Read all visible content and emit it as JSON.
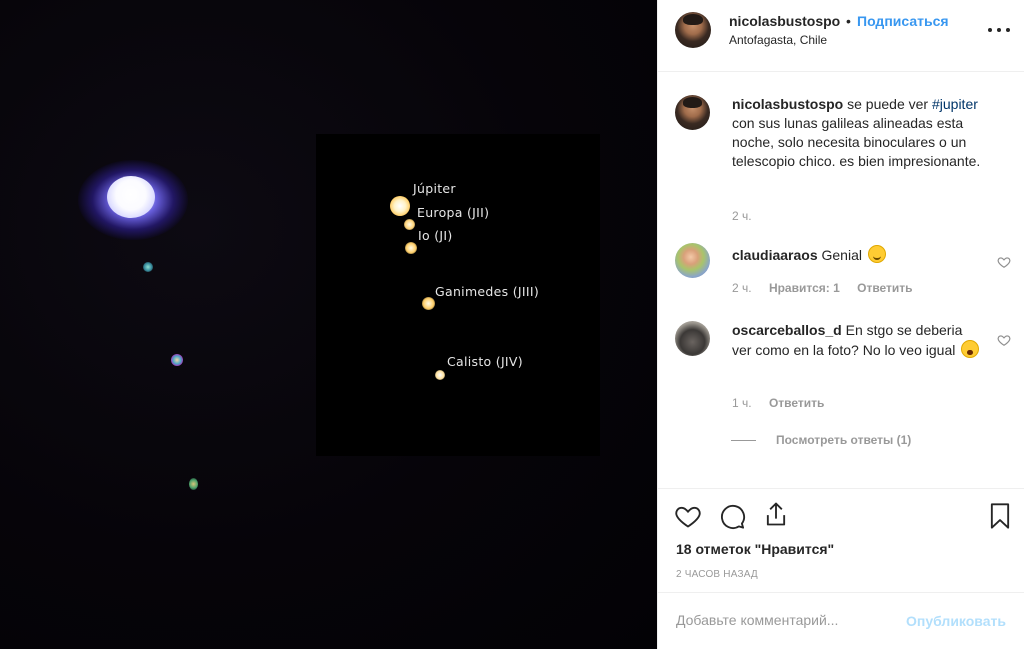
{
  "photo": {
    "labels": {
      "jupiter": "Júpiter",
      "europa": "Europa (JII)",
      "io": "Io (JI)",
      "ganimedes": "Ganimedes (JIII)",
      "calisto": "Calisto (JIV)"
    }
  },
  "header": {
    "username": "nicolasbustospo",
    "separator": "•",
    "follow_label": "Подписаться",
    "location": "Antofagasta, Chile",
    "more_icon": "more-horizontal-icon"
  },
  "caption": {
    "username": "nicolasbustospo",
    "text_before": " se puede ver ",
    "hashtag": "#jupiter",
    "text_after": " con sus lunas galileas alineadas esta noche, solo necesita binoculares o un telescopio chico. es bien impresionante.",
    "time": "2 ч."
  },
  "comments": [
    {
      "username": "claudiaaraos",
      "text": " Genial ",
      "emoji": "smiling-face-emoji",
      "time": "2 ч.",
      "likes_label": "Нравится: 1",
      "reply_label": "Ответить"
    },
    {
      "username": "oscarceballos_d",
      "text": " En stgo se deberia ver como en la foto? No lo veo igual ",
      "emoji": "tired-face-emoji",
      "time": "1 ч.",
      "reply_label": "Ответить",
      "view_replies_label": "Посмотреть ответы (1)"
    }
  ],
  "actions": {
    "icons": [
      "heart-icon",
      "comment-icon",
      "share-icon",
      "bookmark-icon"
    ],
    "likes_text": "18 отметок \"Нравится\"",
    "time_ago": "2 часов назад"
  },
  "comment_box": {
    "placeholder": "Добавьте комментарий...",
    "publish_label": "Опубликовать"
  },
  "colors": {
    "link_blue": "#3897f0",
    "publish_disabled": "#b2dffc",
    "muted": "#999999",
    "text": "#262626"
  }
}
